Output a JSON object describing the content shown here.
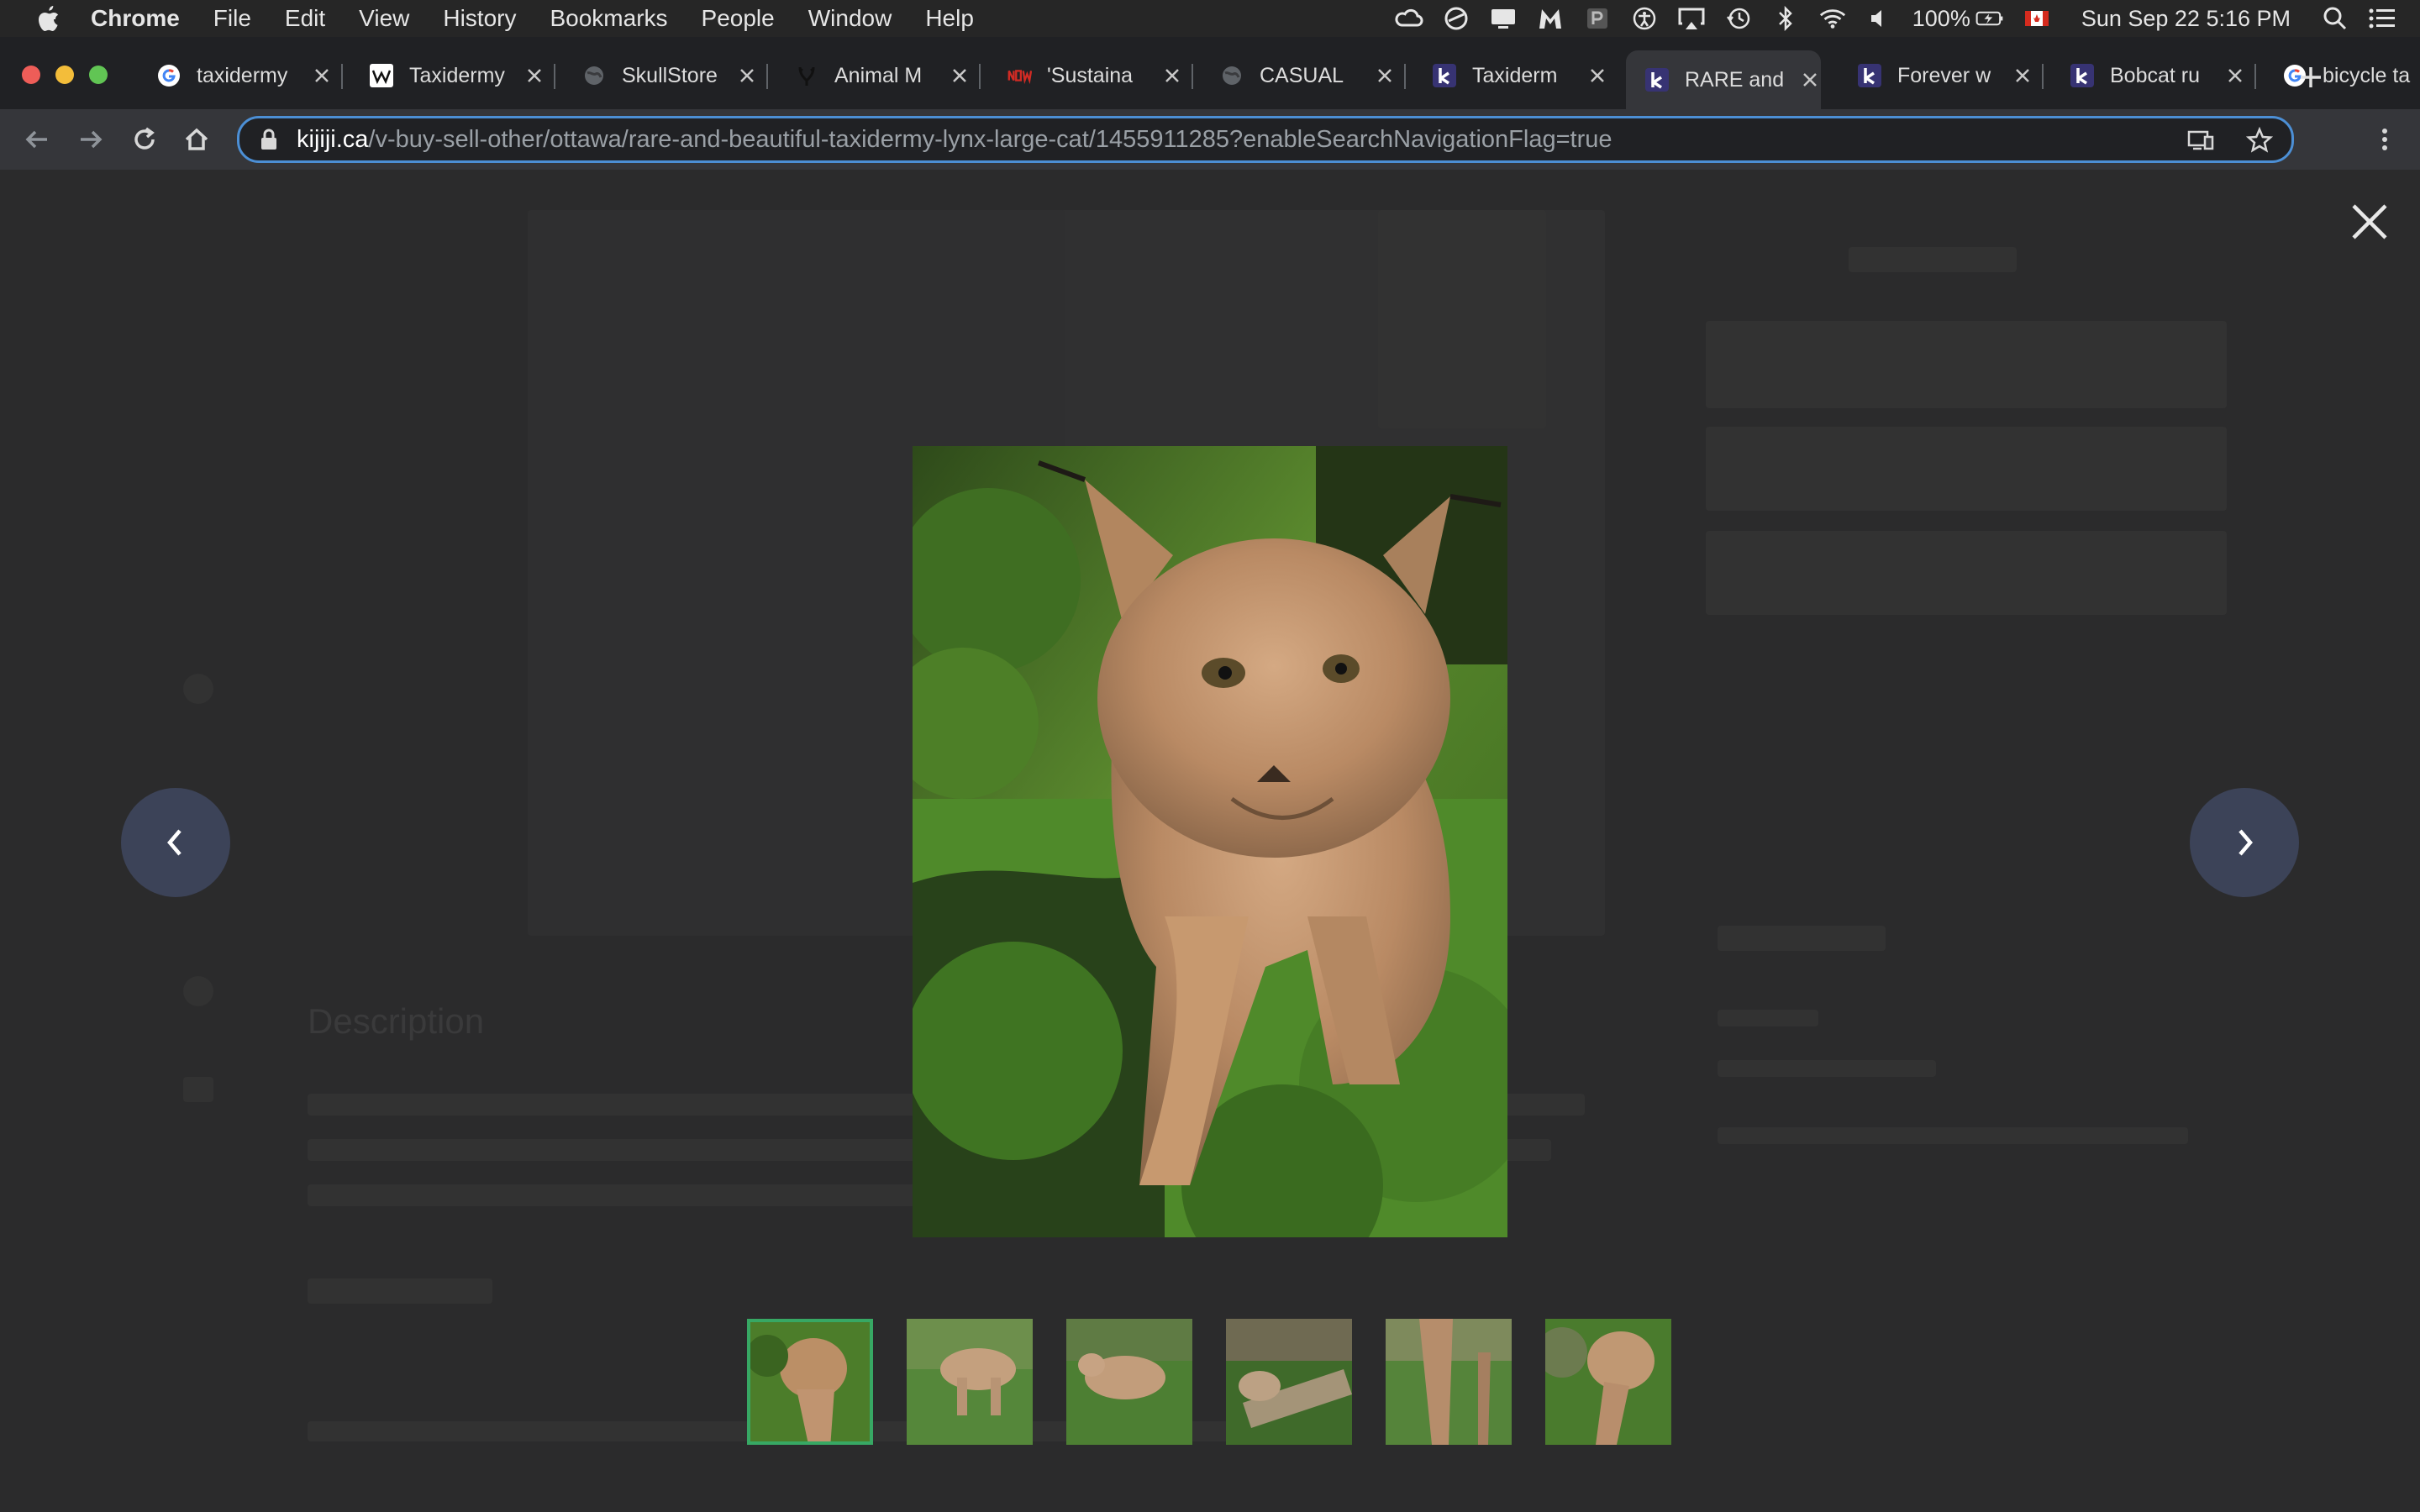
{
  "menubar": {
    "app": "Chrome",
    "items": [
      "File",
      "Edit",
      "View",
      "History",
      "Bookmarks",
      "People",
      "Window",
      "Help"
    ],
    "battery": "100%",
    "datetime": "Sun Sep 22  5:16 PM"
  },
  "tabs": [
    {
      "title": "taxidermy",
      "icon": "google-icon"
    },
    {
      "title": "Taxidermy",
      "icon": "wikipedia-icon"
    },
    {
      "title": "SkullStore",
      "icon": "globe-icon"
    },
    {
      "title": "Animal M",
      "icon": "antler-icon"
    },
    {
      "title": "'Sustaina",
      "icon": "now-icon"
    },
    {
      "title": "CASUAL",
      "icon": "globe-icon"
    },
    {
      "title": "Taxiderm",
      "icon": "kijiji-icon"
    },
    {
      "title": "RARE and",
      "icon": "kijiji-icon",
      "active": true
    },
    {
      "title": "Forever w",
      "icon": "kijiji-icon"
    },
    {
      "title": "Bobcat ru",
      "icon": "kijiji-icon"
    },
    {
      "title": "bicycle ta",
      "icon": "google-icon"
    }
  ],
  "address": {
    "host": "kijiji.ca",
    "path": "/v-buy-sell-other/ottawa/rare-and-beautiful-taxidermy-lynx-large-cat/1455911285?enableSearchNavigationFlag=true"
  },
  "page": {
    "description_heading": "Description"
  },
  "lightbox": {
    "thumbnails": [
      {
        "name": "thumbnail-1",
        "selected": true
      },
      {
        "name": "thumbnail-2"
      },
      {
        "name": "thumbnail-3"
      },
      {
        "name": "thumbnail-4"
      },
      {
        "name": "thumbnail-5"
      },
      {
        "name": "thumbnail-6"
      }
    ]
  },
  "colors": {
    "accent": "#4c8fd5",
    "selected_thumb": "#37a864",
    "nav_button": "#3c4358"
  }
}
